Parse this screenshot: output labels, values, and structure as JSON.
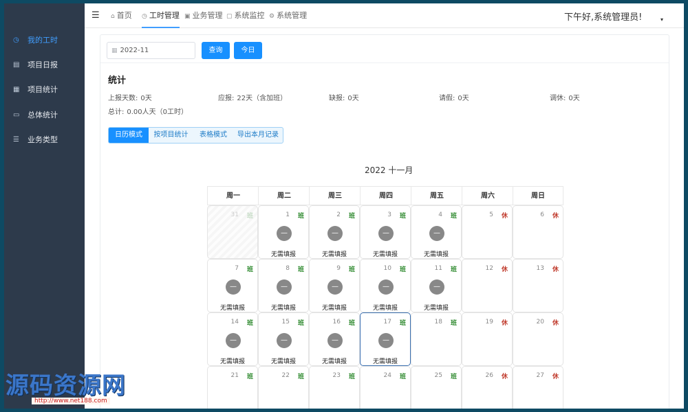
{
  "sidebar": {
    "items": [
      {
        "label": "我的工时",
        "icon": "clock-icon",
        "glyph": "◷"
      },
      {
        "label": "项目日报",
        "icon": "report-icon",
        "glyph": "▤"
      },
      {
        "label": "项目统计",
        "icon": "stats-icon",
        "glyph": "▦"
      },
      {
        "label": "总体统计",
        "icon": "monitor-icon",
        "glyph": "▭"
      },
      {
        "label": "业务类型",
        "icon": "list-icon",
        "glyph": "☰"
      }
    ]
  },
  "topnav": {
    "menu_glyph": "☰",
    "items": [
      {
        "label": "首页",
        "glyph": "⌂"
      },
      {
        "label": "工时管理",
        "glyph": "◷"
      },
      {
        "label": "业务管理",
        "glyph": "▣"
      },
      {
        "label": "系统监控",
        "glyph": "▢"
      },
      {
        "label": "系统管理",
        "glyph": "⚙"
      }
    ],
    "greeting": "下午好,系统管理员!",
    "caret": "▾"
  },
  "search": {
    "month_value": "2022-11",
    "calendar_glyph": "▦",
    "query_label": "查询",
    "today_label": "今日"
  },
  "stats": {
    "title": "统计",
    "reported_days_label": "上报天数:",
    "reported_days_value": "0天",
    "due_label": "应报:",
    "due_value": "22天（含加班）",
    "missing_label": "缺报:",
    "missing_value": "0天",
    "leave_label": "请假:",
    "leave_value": "0天",
    "timeoff_label": "调休:",
    "timeoff_value": "0天",
    "total_label": "总计:",
    "total_value": "0.00人天（0工时）"
  },
  "tabs": [
    "日历模式",
    "按项目统计",
    "表格模式",
    "导出本月记录"
  ],
  "calendar": {
    "title": "2022 十一月",
    "weekdays": [
      "周一",
      "周二",
      "周三",
      "周四",
      "周五",
      "周六",
      "周日"
    ],
    "work_badge": "班",
    "rest_badge": "休",
    "dot_glyph": "—",
    "no_report_text": "无需填报",
    "rows": [
      [
        {
          "day": "31",
          "badge": "班",
          "disabled": true
        },
        {
          "day": "1",
          "badge": "班",
          "status": "无需填报"
        },
        {
          "day": "2",
          "badge": "班",
          "status": "无需填报"
        },
        {
          "day": "3",
          "badge": "班",
          "status": "无需填报"
        },
        {
          "day": "4",
          "badge": "班",
          "status": "无需填报"
        },
        {
          "day": "5",
          "badge": "休"
        },
        {
          "day": "6",
          "badge": "休"
        }
      ],
      [
        {
          "day": "7",
          "badge": "班",
          "status": "无需填报"
        },
        {
          "day": "8",
          "badge": "班",
          "status": "无需填报"
        },
        {
          "day": "9",
          "badge": "班",
          "status": "无需填报"
        },
        {
          "day": "10",
          "badge": "班",
          "status": "无需填报"
        },
        {
          "day": "11",
          "badge": "班",
          "status": "无需填报"
        },
        {
          "day": "12",
          "badge": "休"
        },
        {
          "day": "13",
          "badge": "休"
        }
      ],
      [
        {
          "day": "14",
          "badge": "班",
          "status": "无需填报"
        },
        {
          "day": "15",
          "badge": "班",
          "status": "无需填报"
        },
        {
          "day": "16",
          "badge": "班",
          "status": "无需填报"
        },
        {
          "day": "17",
          "badge": "班",
          "status": "无需填报",
          "today": true
        },
        {
          "day": "18",
          "badge": "班"
        },
        {
          "day": "19",
          "badge": "休"
        },
        {
          "day": "20",
          "badge": "休"
        }
      ],
      [
        {
          "day": "21",
          "badge": "班"
        },
        {
          "day": "22",
          "badge": "班"
        },
        {
          "day": "23",
          "badge": "班"
        },
        {
          "day": "24",
          "badge": "班"
        },
        {
          "day": "25",
          "badge": "班"
        },
        {
          "day": "26",
          "badge": "休"
        },
        {
          "day": "27",
          "badge": "休"
        }
      ]
    ]
  },
  "watermark": {
    "text": "源码资源网",
    "url": "http://www.net188.com"
  },
  "colors": {
    "sidebar_bg": "#2d3a4b",
    "accent": "#1890ff",
    "work_badge": "#2f8a2f",
    "rest_badge": "#c0392b"
  }
}
